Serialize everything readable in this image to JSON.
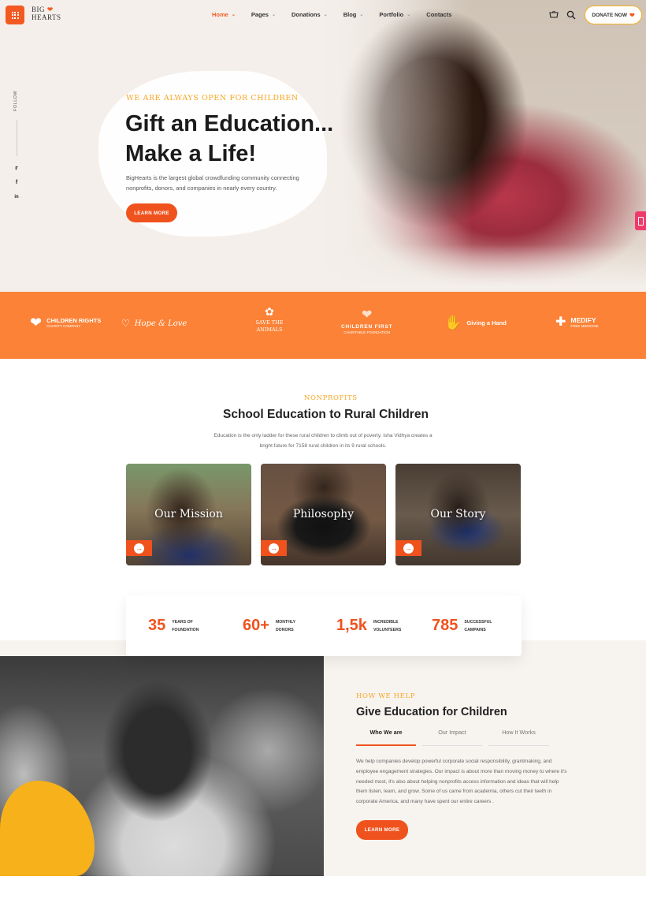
{
  "brand": {
    "logo_line1": "BIG",
    "logo_line2": "HEARTS"
  },
  "nav": {
    "items": [
      {
        "label": "Home",
        "has_dropdown": true,
        "active": true
      },
      {
        "label": "Pages",
        "has_dropdown": true
      },
      {
        "label": "Donations",
        "has_dropdown": true
      },
      {
        "label": "Blog",
        "has_dropdown": true
      },
      {
        "label": "Portfolio",
        "has_dropdown": true
      },
      {
        "label": "Contacts",
        "has_dropdown": false
      }
    ],
    "donate_label": "DONATE NOW"
  },
  "sidebar": {
    "follow_label": "FOLLOW",
    "social": [
      "twitter-icon",
      "facebook-icon",
      "linkedin-icon"
    ]
  },
  "hero": {
    "kicker": "WE ARE ALWAYS OPEN FOR CHILDREN",
    "title_line1": "Gift an Education...",
    "title_line2": "Make a Life!",
    "description": "BigHearts is the largest global crowdfunding community connecting nonprofits, donors, and companies in nearly every country.",
    "button": "LEARN MORE"
  },
  "partners": [
    {
      "name": "CHILDREN RIGHTS",
      "sub": "CHARITY COMPANY"
    },
    {
      "name": "Hope & Love"
    },
    {
      "name": "SAVE THE ANIMALS"
    },
    {
      "name": "CHILDREN FIRST",
      "sub": "CHARITABLE FOUNDATION"
    },
    {
      "name": "Giving a Hand"
    },
    {
      "name": "MEDIFY",
      "sub": "FREE MEDICINE"
    }
  ],
  "nonprofits": {
    "kicker": "NONPROFITS",
    "title": "School Education to Rural Children",
    "description": "Education is the only ladder for these rural children to climb out of poverty. Isha Vidhya creates a bright future for 7158 rural children in its 9 rural schools.",
    "cards": [
      {
        "title": "Our Mission"
      },
      {
        "title": "Philosophy"
      },
      {
        "title": "Our Story"
      }
    ]
  },
  "stats": [
    {
      "value": "35",
      "label_line1": "YEARS OF",
      "label_line2": "FOUNDATION"
    },
    {
      "value": "60+",
      "label_line1": "MONTHLY",
      "label_line2": "DONORS"
    },
    {
      "value": "1,5k",
      "label_line1": "INCREDIBLE",
      "label_line2": "VOLUNTEERS"
    },
    {
      "value": "785",
      "label_line1": "SUCCESSFUL",
      "label_line2": "CAMPAINS"
    }
  ],
  "help": {
    "kicker": "HOW WE HELP",
    "title": "Give Education for Children",
    "tabs": [
      "Who We are",
      "Our Impact",
      "How It Works"
    ],
    "description": "We help companies develop powerful corporate social responsibility, grantmaking, and employee engagement strategies. Our impact is about more than moving money to where it's needed most, it's also about helping nonprofits access information and ideas that will help them listen, learn, and grow. Some of us came from academia, others cut their teeth in corporate America, and many have spent our entire careers .",
    "button": "LEARN MORE"
  },
  "colors": {
    "accent": "#f0521e",
    "band": "#fb8236",
    "kicker": "#f5a623"
  }
}
